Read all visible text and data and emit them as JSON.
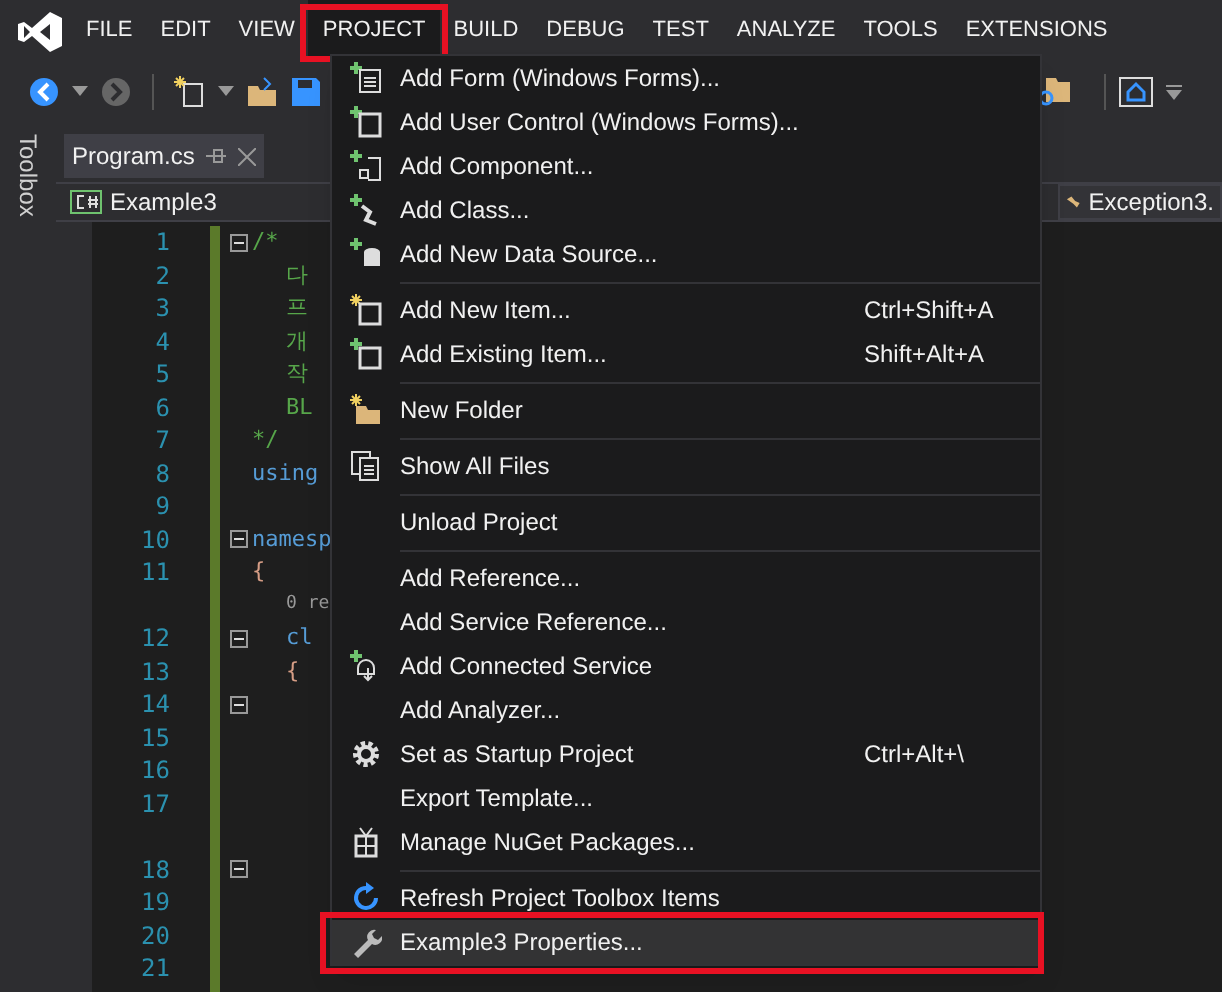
{
  "menu_bar": [
    {
      "label": "FILE",
      "selected": false,
      "annotated": false
    },
    {
      "label": "EDIT",
      "selected": false,
      "annotated": false
    },
    {
      "label": "VIEW",
      "selected": false,
      "annotated": false
    },
    {
      "label": "PROJECT",
      "selected": true,
      "annotated": true
    },
    {
      "label": "BUILD",
      "selected": false,
      "annotated": false
    },
    {
      "label": "DEBUG",
      "selected": false,
      "annotated": false
    },
    {
      "label": "TEST",
      "selected": false,
      "annotated": false
    },
    {
      "label": "ANALYZE",
      "selected": false,
      "annotated": false
    },
    {
      "label": "TOOLS",
      "selected": false,
      "annotated": false
    },
    {
      "label": "EXTENSIONS",
      "selected": false,
      "annotated": false
    }
  ],
  "side_strip": {
    "label": "Toolbox"
  },
  "document_tab": {
    "title": "Program.cs"
  },
  "nav_bar": {
    "project": "Example3",
    "member": "Exception3."
  },
  "editor_lines": [
    {
      "number": "1",
      "text": "/*",
      "kind": "comment",
      "fold": true
    },
    {
      "number": "2",
      "text": "다",
      "kind": "comment",
      "fold": false
    },
    {
      "number": "3",
      "text": "프",
      "kind": "comment",
      "fold": false
    },
    {
      "number": "4",
      "text": "개",
      "kind": "comment",
      "fold": false
    },
    {
      "number": "5",
      "text": "작",
      "kind": "comment",
      "fold": false
    },
    {
      "number": "6",
      "text": "BL",
      "kind": "comment",
      "fold": false
    },
    {
      "number": "7",
      "text": "*/",
      "kind": "comment",
      "fold": false
    },
    {
      "number": "8",
      "text": "using",
      "kind": "keyword",
      "fold": false
    },
    {
      "number": "9",
      "fold": false
    },
    {
      "number": "10",
      "text": "namesp",
      "kind": "keyword",
      "fold": true
    },
    {
      "number": "11",
      "text": "{",
      "kind": "brace",
      "fold": false
    },
    {
      "text": "0 re",
      "kind": "codelens",
      "fold": false
    },
    {
      "number": "12",
      "text": "cl",
      "kind": "keyword",
      "fold": true
    },
    {
      "number": "13",
      "text": "{",
      "kind": "brace",
      "fold": false
    },
    {
      "number": "14",
      "fold": true
    },
    {
      "number": "15",
      "fold": false
    },
    {
      "number": "16",
      "fold": false
    },
    {
      "number": "17",
      "fold": false
    },
    {
      "fold": false
    },
    {
      "number": "18",
      "fold": true
    },
    {
      "number": "19",
      "fold": false
    },
    {
      "number": "20",
      "fold": false
    },
    {
      "number": "21",
      "fold": false
    }
  ],
  "project_menu": [
    [
      {
        "label": "Add Form (Windows Forms)...",
        "selected": false,
        "annotated": false
      },
      {
        "label": "Add User Control (Windows Forms)...",
        "selected": false,
        "annotated": false
      },
      {
        "label": "Add Component...",
        "selected": false,
        "annotated": false
      },
      {
        "label": "Add Class...",
        "selected": false,
        "annotated": false
      },
      {
        "label": "Add New Data Source...",
        "selected": false,
        "annotated": false
      }
    ],
    [
      {
        "label": "Add New Item...",
        "shortcut": "Ctrl+Shift+A",
        "selected": false,
        "annotated": false
      },
      {
        "label": "Add Existing Item...",
        "shortcut": "Shift+Alt+A",
        "selected": false,
        "annotated": false
      }
    ],
    [
      {
        "label": "New Folder",
        "selected": false,
        "annotated": false
      }
    ],
    [
      {
        "label": "Show All Files",
        "selected": false,
        "annotated": false
      }
    ],
    [
      {
        "label": "Unload Project",
        "selected": false,
        "annotated": false
      }
    ],
    [
      {
        "label": "Add Reference...",
        "selected": false,
        "annotated": false
      },
      {
        "label": "Add Service Reference...",
        "selected": false,
        "annotated": false
      },
      {
        "label": "Add Connected Service",
        "selected": false,
        "annotated": false
      },
      {
        "label": "Add Analyzer...",
        "selected": false,
        "annotated": false
      },
      {
        "label": "Set as Startup Project",
        "shortcut": "Ctrl+Alt+\\",
        "selected": false,
        "annotated": false
      },
      {
        "label": "Export Template...",
        "selected": false,
        "annotated": false
      },
      {
        "label": "Manage NuGet Packages...",
        "selected": false,
        "annotated": false
      }
    ],
    [
      {
        "label": "Refresh Project Toolbox Items",
        "selected": false,
        "annotated": false
      },
      {
        "label": "Example3 Properties...",
        "selected": true,
        "annotated": true
      }
    ]
  ]
}
